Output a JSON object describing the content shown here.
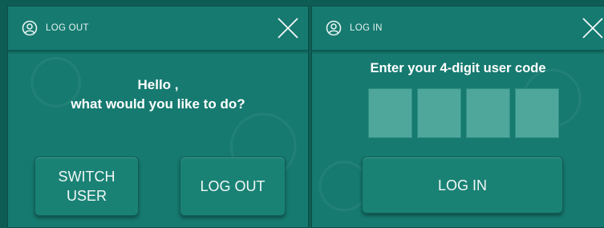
{
  "colors": {
    "background": "#0e5d55",
    "panel": "#167a70",
    "button": "#1a8275",
    "code_box": "#4fa79b",
    "text": "#ffffff"
  },
  "logout_panel": {
    "title": "LOG OUT",
    "icon": "user-circle-icon",
    "close_icon": "close-icon",
    "greeting_line1": "Hello ,",
    "greeting_line2": "what would you like to do?",
    "switch_user_line1": "SWITCH",
    "switch_user_line2": "USER",
    "logout_label": "LOG OUT"
  },
  "login_panel": {
    "title": "LOG IN",
    "icon": "user-circle-icon",
    "close_icon": "close-icon",
    "prompt": "Enter your 4-digit user code",
    "code_digits": [
      "",
      "",
      "",
      ""
    ],
    "login_label": "LOG IN"
  }
}
